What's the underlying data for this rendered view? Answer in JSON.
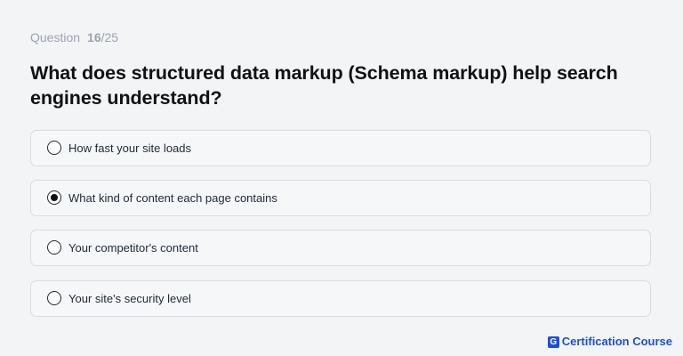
{
  "quiz": {
    "counter": {
      "label": "Question",
      "current": "16",
      "separator": "/",
      "total": "25"
    },
    "question": "What does structured data markup (Schema markup) help search engines understand?",
    "options": [
      {
        "label": "How fast your site loads",
        "selected": false
      },
      {
        "label": "What kind of content each page contains",
        "selected": true
      },
      {
        "label": "Your competitor's content",
        "selected": false
      },
      {
        "label": "Your site's security level",
        "selected": false
      }
    ]
  },
  "brand": {
    "logo_letter": "G",
    "name": "Certification Course",
    "color": "#1d4ed8"
  },
  "colors": {
    "background": "#f3f4f6",
    "option_border": "#d9dce1",
    "question_text": "#111111",
    "muted_text": "#9ca3af"
  }
}
